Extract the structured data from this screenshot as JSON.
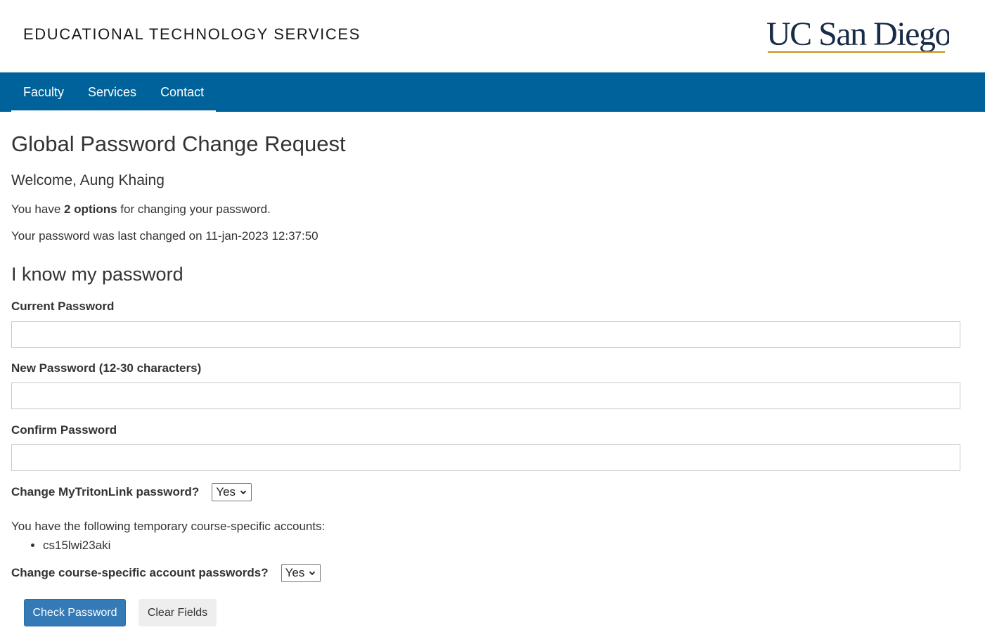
{
  "header": {
    "site_title": "EDUCATIONAL TECHNOLOGY SERVICES",
    "logo_text": "UC San Diego",
    "logo_colors": {
      "text": "#182b49",
      "underline": "#c69214"
    }
  },
  "nav": {
    "background": "#00629b",
    "items": [
      {
        "label": "Faculty"
      },
      {
        "label": "Services"
      },
      {
        "label": "Contact"
      }
    ]
  },
  "page": {
    "title": "Global Password Change Request",
    "welcome": "Welcome, Aung Khaing",
    "options_prefix": "You have ",
    "options_bold": "2 options",
    "options_suffix": " for changing your password.",
    "last_changed": "Your password was last changed on 11-jan-2023 12:37:50"
  },
  "form": {
    "section_title": "I know my password",
    "current_password_label": "Current Password",
    "current_password_value": "",
    "new_password_label": "New Password (12-30 characters)",
    "new_password_value": "",
    "confirm_password_label": "Confirm Password",
    "confirm_password_value": "",
    "mytritonlink_label": "Change MyTritonLink password?",
    "mytritonlink_selected": "Yes",
    "temp_accounts_text": "You have the following temporary course-specific accounts:",
    "temp_accounts": [
      "cs15lwi23aki"
    ],
    "course_accounts_label": "Change course-specific account passwords?",
    "course_accounts_selected": "Yes",
    "check_button": "Check Password",
    "clear_button": "Clear Fields",
    "primary_color": "#337ab7"
  }
}
